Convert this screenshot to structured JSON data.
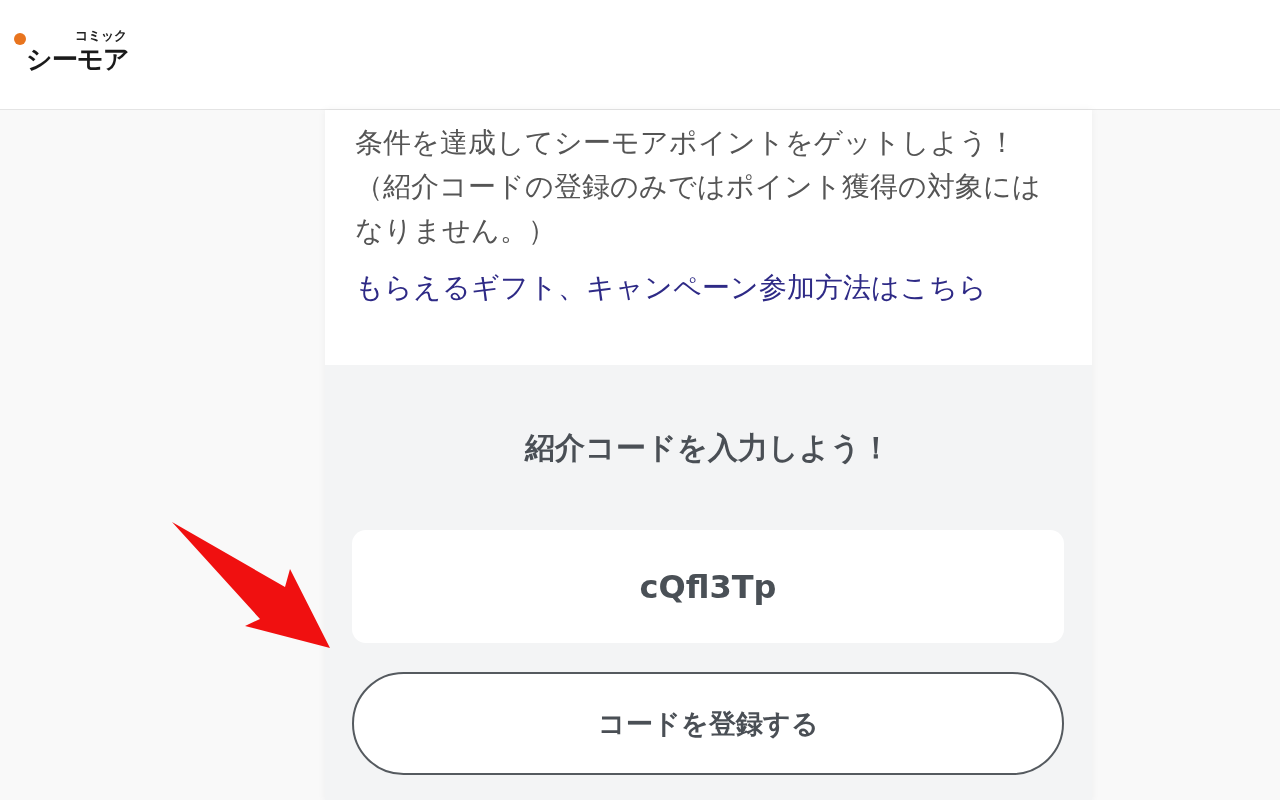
{
  "header": {
    "logo": {
      "small_text": "コミック",
      "main_text": "シーモア"
    }
  },
  "info": {
    "description": [
      "条件を達成してシーモアポイントをゲットしよう！",
      "（紹介コードの登録のみではポイント獲得の対象にはなりません。）"
    ],
    "link": "もらえるギフト、キャンペーン参加方法はこちら"
  },
  "referral": {
    "heading": "紹介コードを入力しよう！",
    "code_field": {
      "value": "cQfl3Tp"
    },
    "submit_button": "コードを登録する"
  },
  "annotations": [
    {
      "kind": "arrow"
    }
  ]
}
